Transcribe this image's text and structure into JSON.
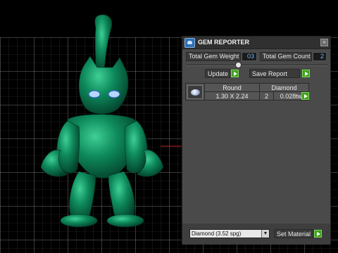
{
  "panel": {
    "title": "GEM REPORTER",
    "close_glyph": "×",
    "total_weight_label": "Total Gem Weight",
    "total_weight_value": "03",
    "total_count_label": "Total Gem Count",
    "total_count_value": "2",
    "update_label": "Update",
    "save_report_label": "Save Report",
    "table": {
      "headers": [
        "Round",
        "Diamond"
      ],
      "row": {
        "size": "1.30 X 2.24",
        "count": "2",
        "weight": "0.028tw"
      }
    },
    "material_select": "Diamond    (3.52 spg)",
    "set_material_label": "Set Material"
  },
  "colors": {
    "model": "#0e7a52",
    "grid": "#6a6a6a",
    "axis": "#c21f1f",
    "go_button": "#3ea21f",
    "value_text": "#63b8ff"
  },
  "icons": [
    "app-logo-icon",
    "close-icon",
    "slider-knob",
    "gem-thumbnail-icon",
    "play-arrow-icon",
    "dropdown-arrow-icon"
  ]
}
